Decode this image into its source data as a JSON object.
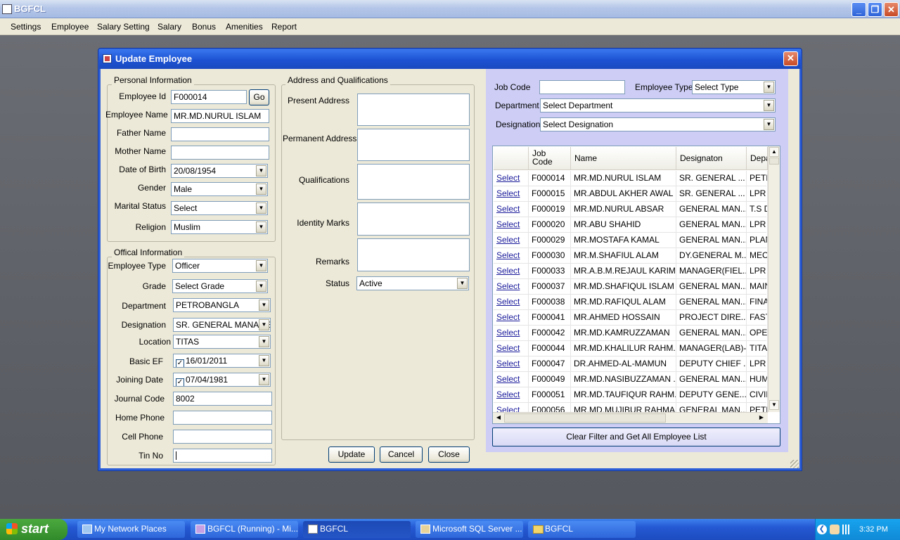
{
  "app": {
    "title": "BGFCL"
  },
  "menu": [
    "Settings",
    "Employee",
    "Salary Setting",
    "Salary",
    "Bonus",
    "Amenities",
    "Report"
  ],
  "dialog": {
    "title": "Update Employee"
  },
  "personal": {
    "group_title": "Personal Information",
    "employee_id_label": "Employee Id",
    "employee_id": "F000014",
    "go_label": "Go",
    "employee_name_label": "Employee Name",
    "employee_name": "MR.MD.NURUL ISLAM",
    "father_label": "Father Name",
    "father": "",
    "mother_label": "Mother Name",
    "mother": "",
    "dob_label": "Date of Birth",
    "dob": "20/08/1954",
    "gender_label": "Gender",
    "gender": "Male",
    "marital_label": "Marital Status",
    "marital": "Select",
    "religion_label": "Religion",
    "religion": "Muslim"
  },
  "official": {
    "group_title": "Offical Information",
    "emp_type_label": "Employee Type",
    "emp_type": "Officer",
    "grade_label": "Grade",
    "grade": "Select Grade",
    "dept_label": "Department",
    "dept": "PETROBANGLA",
    "desig_label": "Designation",
    "desig": "SR. GENERAL MANAGER",
    "location_label": "Location",
    "location": "TITAS",
    "basic_ef_label": "Basic EF",
    "basic_ef": "16/01/2011",
    "joining_label": "Joining Date",
    "joining": "07/04/1981",
    "journal_label": "Journal Code",
    "journal": "8002",
    "home_phone_label": "Home Phone",
    "home_phone": "",
    "cell_label": "Cell Phone",
    "cell": "",
    "tin_label": "Tin No",
    "tin": ""
  },
  "address": {
    "group_title": "Address and Qualifications",
    "present_label": "Present Address",
    "permanent_label": "Permanent Address",
    "qual_label": "Qualifications",
    "identity_label": "Identity Marks",
    "remarks_label": "Remarks",
    "status_label": "Status",
    "status": "Active"
  },
  "buttons": {
    "update": "Update",
    "cancel": "Cancel",
    "close": "Close"
  },
  "filter": {
    "job_code_label": "Job Code",
    "job_code": "",
    "emp_type_label": "Employee Type",
    "emp_type": "Select Type",
    "dept_label": "Department",
    "dept": "Select Department",
    "desig_label": "Designation",
    "desig": "Select Designation",
    "clear_label": "Clear Filter and Get All Employee List"
  },
  "grid": {
    "headers": [
      "",
      "Job Code",
      "Name",
      "Designaton",
      "Depa"
    ],
    "rows": [
      [
        "Select",
        "F000014",
        "MR.MD.NURUL ISLAM",
        "SR. GENERAL ...",
        "PETR"
      ],
      [
        "Select",
        "F000015",
        "MR.ABDUL AKHER AWAL",
        "SR. GENERAL ...",
        "LPR I"
      ],
      [
        "Select",
        "F000019",
        "MR.MD.NURUL ABSAR",
        "GENERAL MAN...",
        "T.S D"
      ],
      [
        "Select",
        "F000020",
        "MR.ABU SHAHID",
        "GENERAL MAN...",
        "LPR I"
      ],
      [
        "Select",
        "F000029",
        "MR.MOSTAFA KAMAL",
        "GENERAL MAN...",
        "PLAN"
      ],
      [
        "Select",
        "F000030",
        "MR.M.SHAFIUL ALAM",
        "DY.GENERAL M...",
        "MECH"
      ],
      [
        "Select",
        "F000033",
        "MR.A.B.M.REJAUL KARIM",
        "MANAGER(FIEL...",
        "LPR I"
      ],
      [
        "Select",
        "F000037",
        "MR.MD.SHAFIQUL ISLAM",
        "GENERAL MAN...",
        "MAIN"
      ],
      [
        "Select",
        "F000038",
        "MR.MD.RAFIQUL ALAM",
        "GENERAL MAN...",
        "FINAI"
      ],
      [
        "Select",
        "F000041",
        "MR.AHMED HOSSAIN",
        "PROJECT DIRE...",
        "FAST"
      ],
      [
        "Select",
        "F000042",
        "MR.MD.KAMRUZZAMAN",
        "GENERAL MAN...",
        "OPEF"
      ],
      [
        "Select",
        "F000044",
        "MR.MD.KHALILUR RAHM...",
        "MANAGER(LAB)-...",
        "TITAS"
      ],
      [
        "Select",
        "F000047",
        "DR.AHMED-AL-MAMUN",
        "DEPUTY CHIEF ...",
        "LPR I"
      ],
      [
        "Select",
        "F000049",
        "MR.MD.NASIBUZZAMAN ...",
        "GENERAL MAN...",
        "HUMA"
      ],
      [
        "Select",
        "F000051",
        "MR.MD.TAUFIQUR RAHM...",
        "DEPUTY GENE...",
        "CIVIL"
      ],
      [
        "Select",
        "F000056",
        "MR.MD.MUJIBUR RAHMAN",
        "GENERAL MAN...",
        "PETF"
      ]
    ]
  },
  "taskbar": {
    "start": "start",
    "items": [
      "My Network Places",
      "BGFCL (Running) - Mi...",
      "BGFCL",
      "Microsoft SQL Server ...",
      "BGFCL"
    ],
    "time": "3:32 PM"
  }
}
